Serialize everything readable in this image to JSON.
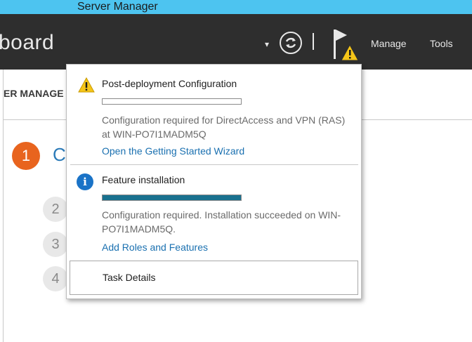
{
  "window": {
    "title": "Server Manager"
  },
  "header": {
    "page_title": "board",
    "menu": {
      "manage": "Manage",
      "tools": "Tools"
    }
  },
  "section_label": "ER MANAGE",
  "steps": {
    "step1_number": "1",
    "step1_text": "C",
    "step2": "2",
    "step3": "3",
    "step4": "4"
  },
  "notifications": [
    {
      "icon": "warning-icon",
      "heading": "Post-deployment Configuration",
      "progress": 0,
      "description": "Configuration required for DirectAccess and VPN (RAS) at WIN-PO7I1MADM5Q",
      "link": "Open the Getting Started Wizard"
    },
    {
      "icon": "info-icon",
      "heading": "Feature installation",
      "progress": 1,
      "description": "Configuration required. Installation succeeded on WIN-PO7I1MADM5Q.",
      "link": "Add Roles and Features"
    }
  ],
  "task_details": "Task Details",
  "colors": {
    "titlebar": "#4dc4f0",
    "header": "#2e2e2e",
    "accent_orange": "#e8641e",
    "link": "#1a70b0",
    "progress": "#19718f",
    "info": "#1a73c7",
    "warning": "#f5c518"
  }
}
